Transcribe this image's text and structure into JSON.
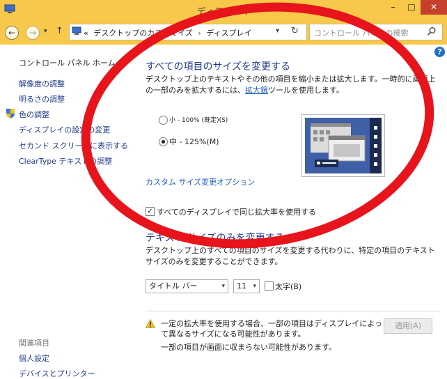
{
  "window": {
    "title": "ディスプレイ",
    "min_glyph": "–",
    "max_glyph": "□",
    "close_glyph": "✕"
  },
  "nav": {
    "back_glyph": "←",
    "forward_glyph": "→",
    "dropdown_glyph": "▾",
    "up_glyph": "↑",
    "address_prefix": "«",
    "breadcrumb": [
      "デスクトップのカスタマイズ",
      "ディスプレイ"
    ],
    "breadcrumb_sep": "›",
    "refresh_glyph": "↻",
    "search_placeholder": "コントロール パネルの検索"
  },
  "sidebar": {
    "home": "コントロール パネル ホーム",
    "items": [
      {
        "label": "解像度の調整"
      },
      {
        "label": "明るさの調整"
      },
      {
        "label": "色の調整"
      },
      {
        "label": "ディスプレイの設定の変更"
      },
      {
        "label": "セカンド スクリーンに表示する"
      },
      {
        "label": "ClearType テキストの調整"
      }
    ],
    "related_heading": "関連項目",
    "related": [
      {
        "label": "個人設定"
      },
      {
        "label": "デバイスとプリンター"
      }
    ]
  },
  "main": {
    "help_glyph": "?",
    "section1": {
      "title": "すべての項目のサイズを変更する",
      "desc_before": "デスクトップ上のテキストやその他の項目を縮小または拡大します。一時的に画面上の一部のみを拡大するには、",
      "desc_link": "拡大鏡",
      "desc_after": "ツールを使用します。",
      "options": [
        {
          "label": "小 - 100% (既定)(S)",
          "selected": false
        },
        {
          "label": "中 - 125%(M)",
          "selected": true
        }
      ],
      "custom_link": "カスタム サイズ変更オプション",
      "same_scale_label": "すべてのディスプレイで同じ拡大率を使用する",
      "same_scale_checked": true
    },
    "section2": {
      "title": "テキスト サイズのみを変更する",
      "desc": "デスクトップ上のすべての項目のサイズを変更する代わりに、特定の項目のテキスト サイズのみを変更することができます。",
      "item_select": "タイトル バー",
      "size_select": "11",
      "bold_label": "太字(B)",
      "bold_checked": false
    },
    "warning": {
      "line1": "一定の拡大率を使用する場合、一部の項目はディスプレイによって異なるサイズになる可能性があります。",
      "line2": "一部の項目が画面に収まらない可能性があります。"
    },
    "apply_label": "適用(A)"
  },
  "colors": {
    "titlebar": "#f7c84a",
    "annotation": "#e8141c",
    "link": "#1f5fbf",
    "heading": "#1e3a8a"
  }
}
